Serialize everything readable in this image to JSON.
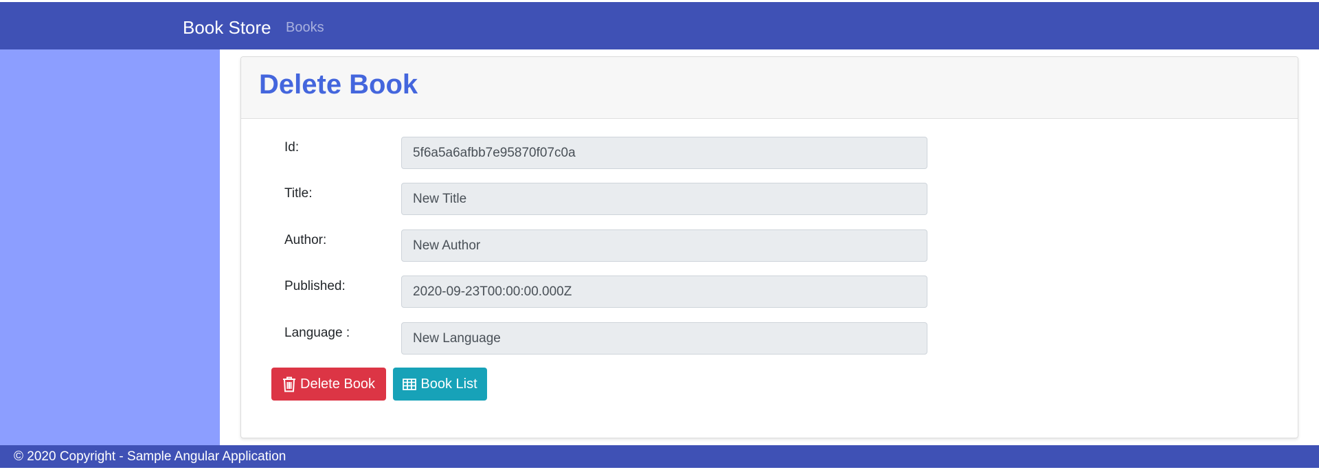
{
  "navbar": {
    "brand": "Book Store",
    "links": [
      "Books"
    ]
  },
  "page": {
    "title": "Delete Book"
  },
  "form": {
    "fields": [
      {
        "label": "Id:",
        "value": "5f6a5a6afbb7e95870f07c0a"
      },
      {
        "label": "Title:",
        "value": "New Title"
      },
      {
        "label": "Author:",
        "value": "New Author"
      },
      {
        "label": "Published:",
        "value": "2020-09-23T00:00:00.000Z"
      },
      {
        "label": "Language :",
        "value": "New Language"
      }
    ]
  },
  "actions": {
    "delete_label": "Delete Book",
    "delete_icon": "trash-icon",
    "list_label": "Book List",
    "list_icon": "table-icon"
  },
  "footer": {
    "text": "© 2020 Copyright - Sample Angular Application"
  },
  "colors": {
    "navbar": "#3f51b5",
    "sidebar": "#8c9eff",
    "title": "#4466dd",
    "delete_button": "#dc3545",
    "list_button": "#17a2b8"
  }
}
